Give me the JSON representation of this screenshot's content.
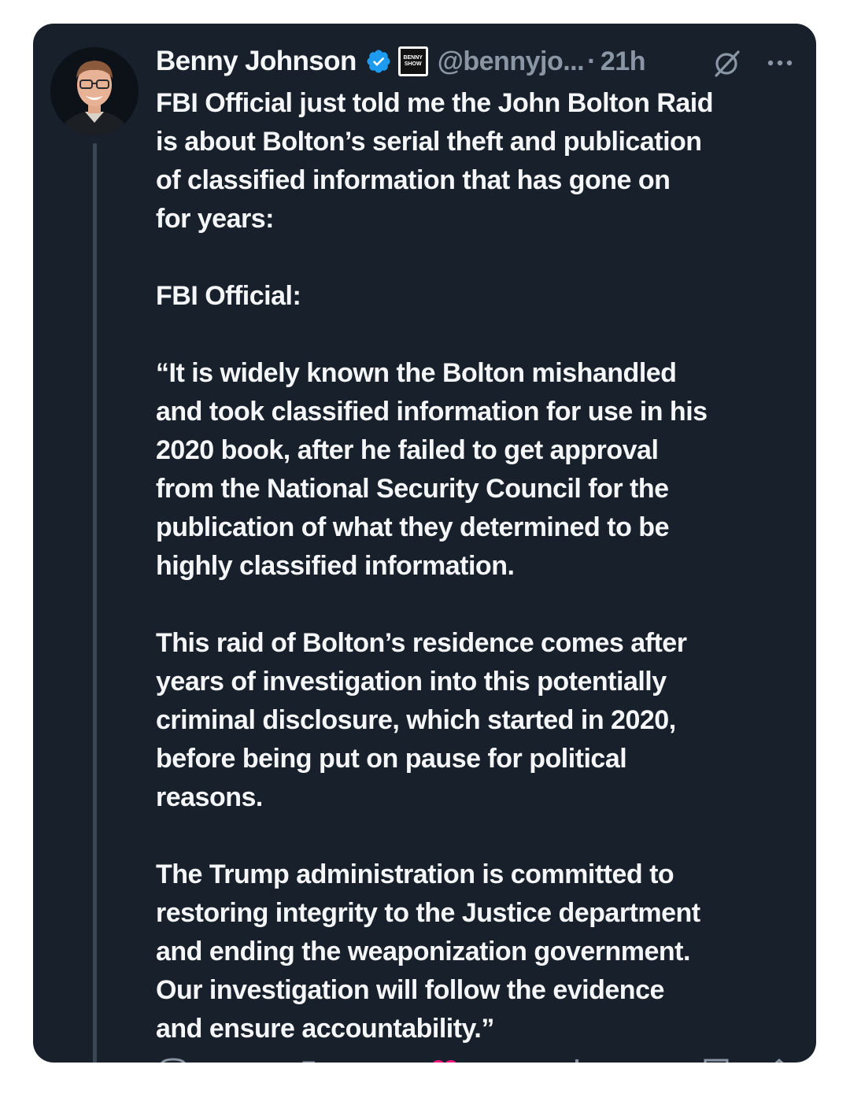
{
  "author": {
    "name": "Benny Johnson",
    "handle": "@bennyjo...",
    "separator": "·",
    "time": "21h",
    "affiliate_badge_text": "BENNY SHOW"
  },
  "icons": {
    "verified": "verified-badge-icon",
    "grok": "grok-icon",
    "more": "more-options-icon",
    "accent": "#1d9bf0",
    "like_color": "#f91880"
  },
  "tweet": {
    "lines": [
      "FBI Official just told me the John Bolton Raid",
      "is about Bolton’s serial theft and publication",
      "of classified information that has gone on",
      "for years:",
      "",
      "FBI Official:",
      "",
      "“It is widely known the Bolton mishandled",
      "and took classified information for use in his",
      "2020 book, after he failed to get approval",
      "from the National Security Council for the",
      "publication of what they determined to be",
      "highly classified information.",
      "",
      "This raid of Bolton’s residence comes after",
      "years of investigation into this potentially",
      "criminal disclosure, which started in 2020,",
      "before being put on pause for political",
      "reasons.",
      "",
      "The Trump administration is committed to",
      "restoring integrity to the Justice department",
      "and ending the weaponization government.",
      "Our investigation will follow the evidence",
      "and ensure accountability.”"
    ]
  },
  "colors": {
    "card_bg": "#17202b",
    "text": "#f4f6f8",
    "muted": "#8a96a3"
  }
}
